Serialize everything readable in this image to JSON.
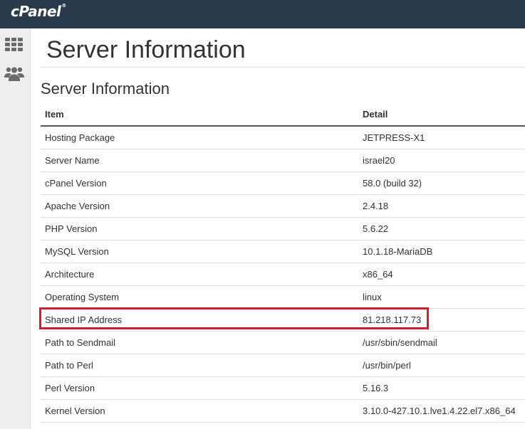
{
  "header": {
    "logo": "cPanel",
    "logo_mark": "®"
  },
  "sidebar": {
    "icons": [
      "apps-grid-icon",
      "users-icon"
    ]
  },
  "page": {
    "title": "Server Information",
    "section_title": "Server Information"
  },
  "table": {
    "headers": {
      "item": "Item",
      "detail": "Detail"
    },
    "rows": [
      {
        "item": "Hosting Package",
        "detail": "JETPRESS-X1"
      },
      {
        "item": "Server Name",
        "detail": "israel20"
      },
      {
        "item": "cPanel Version",
        "detail": "58.0 (build 32)"
      },
      {
        "item": "Apache Version",
        "detail": "2.4.18"
      },
      {
        "item": "PHP Version",
        "detail": "5.6.22"
      },
      {
        "item": "MySQL Version",
        "detail": "10.1.18-MariaDB"
      },
      {
        "item": "Architecture",
        "detail": "x86_64"
      },
      {
        "item": "Operating System",
        "detail": "linux"
      },
      {
        "item": "Shared IP Address",
        "detail": "81.218.117.73"
      },
      {
        "item": "Path to Sendmail",
        "detail": "/usr/sbin/sendmail"
      },
      {
        "item": "Path to Perl",
        "detail": "/usr/bin/perl"
      },
      {
        "item": "Perl Version",
        "detail": "5.16.3"
      },
      {
        "item": "Kernel Version",
        "detail": "3.10.0-427.10.1.lve1.4.22.el7.x86_64"
      }
    ]
  },
  "colors": {
    "topbar": "#293a4a",
    "sidebar": "#eeeeee",
    "icon": "#6b6b6b",
    "highlight": "#d0202e"
  }
}
